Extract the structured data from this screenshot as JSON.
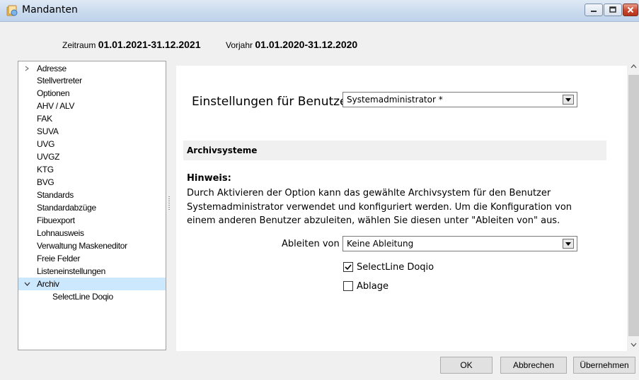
{
  "window": {
    "title": "Mandanten"
  },
  "period": {
    "zeitraum_label": "Zeitraum",
    "zeitraum_value": "01.01.2021-31.12.2021",
    "vorjahr_label": "Vorjahr",
    "vorjahr_value": "01.01.2020-31.12.2020"
  },
  "sidebar": {
    "items": [
      {
        "label": "Adresse",
        "expander": "collapsed"
      },
      {
        "label": "Stellvertreter"
      },
      {
        "label": "Optionen"
      },
      {
        "label": "AHV / ALV"
      },
      {
        "label": "FAK"
      },
      {
        "label": "SUVA"
      },
      {
        "label": "UVG"
      },
      {
        "label": "UVGZ"
      },
      {
        "label": "KTG"
      },
      {
        "label": "BVG"
      },
      {
        "label": "Standards"
      },
      {
        "label": "Standardabzüge"
      },
      {
        "label": "Fibuexport"
      },
      {
        "label": "Lohnausweis"
      },
      {
        "label": "Verwaltung Maskeneditor"
      },
      {
        "label": "Freie Felder"
      },
      {
        "label": "Listeneinstellungen"
      },
      {
        "label": "Archiv",
        "expander": "expanded",
        "selected": true
      },
      {
        "label": "SelectLine Doqio",
        "child": true
      }
    ]
  },
  "main": {
    "settings_label": "Einstellungen für Benutzer",
    "user_select_value": "Systemadministrator *",
    "section_title": "Archivsysteme",
    "hint_title": "Hinweis:",
    "hint_lines": [
      "Durch Aktivieren der Option kann das gewählte Archivsystem für den Benutzer",
      "Systemadministrator verwendet und konfiguriert werden. Um die Konfiguration von",
      "einem anderen Benutzer abzuleiten, wählen Sie diesen unter \"Ableiten von\" aus."
    ],
    "derive_label": "Ableiten von",
    "derive_select_value": "Keine Ableitung",
    "checkboxes": [
      {
        "label": "SelectLine Doqio",
        "checked": true
      },
      {
        "label": "Ablage",
        "checked": false
      }
    ]
  },
  "footer": {
    "ok_label": "OK",
    "cancel_label": "Abbrechen",
    "apply_label": "Übernehmen"
  },
  "colors": {
    "selection": "#cce8ff",
    "section_bg": "#f0f0f0",
    "close_button": "#c7452c"
  }
}
